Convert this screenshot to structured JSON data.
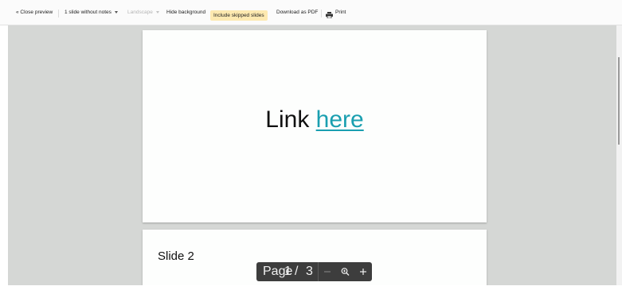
{
  "toolbar": {
    "close_preview": "« Close preview",
    "layout_select": "1 slide without notes",
    "orientation_select": "Landscape",
    "hide_background": "Hide background",
    "include_skipped": "Include skipped slides",
    "download_pdf": "Download as PDF",
    "print": "Print",
    "include_skipped_highlight_color": "#fde9b0"
  },
  "slides": [
    {
      "text": "Link ",
      "link_text": "here",
      "link_color": "#1a9fb0"
    },
    {
      "title": "Slide 2"
    }
  ],
  "pager": {
    "page_label": "Page",
    "current_page": "1",
    "separator": "/",
    "total_pages": "3",
    "zoom_out_icon": "minus-icon",
    "zoom_icon": "zoom-icon",
    "zoom_in_icon": "plus-icon"
  },
  "colors": {
    "viewer_background": "#d5d7d5",
    "pager_background": "#3d3d3d"
  }
}
